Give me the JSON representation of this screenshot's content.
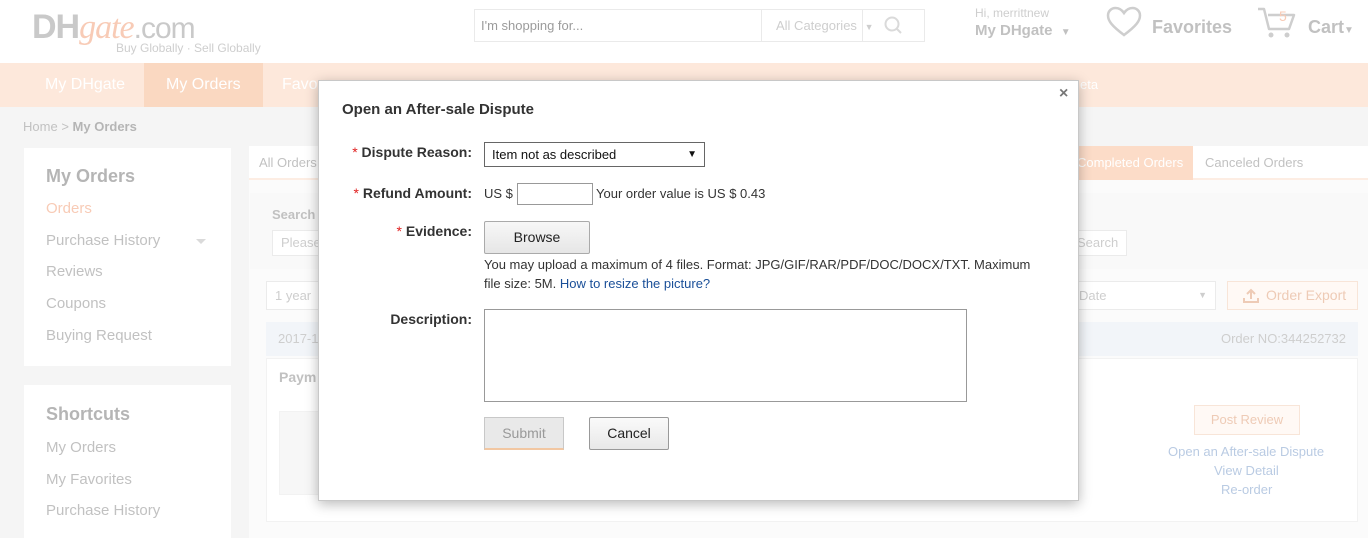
{
  "header": {
    "logo": {
      "dh": "DH",
      "gate": "gate",
      "com": ".com",
      "tagline": "Buy Globally · Sell Globally"
    },
    "search": {
      "placeholder": "I'm shopping for...",
      "category": "All Categories"
    },
    "user": {
      "greeting": "Hi, merrittnew",
      "account_label": "My DHgate"
    },
    "favorites_label": "Favorites",
    "cart": {
      "count": "5",
      "label": "Cart"
    }
  },
  "nav": {
    "items": [
      {
        "label": "My DHgate"
      },
      {
        "label": "My Orders"
      },
      {
        "label": "Favo"
      }
    ],
    "beta_label": "eta"
  },
  "breadcrumb": {
    "home": "Home",
    "separator": ">",
    "current": "My Orders"
  },
  "sidebar": {
    "orders_title": "My Orders",
    "orders_items": [
      "Orders",
      "Purchase History",
      "Reviews",
      "Coupons",
      "Buying Request"
    ],
    "shortcuts_title": "Shortcuts",
    "shortcut_items": [
      "My Orders",
      "My Favorites",
      "Purchase History"
    ]
  },
  "tabs": {
    "all": "All Orders",
    "completed": "Completed Orders",
    "canceled": "Canceled Orders"
  },
  "search_area": {
    "label": "Search",
    "placeholder": "Please",
    "search_button": "Search",
    "period": "1 year",
    "date_field": "Date",
    "export_label": "Order Export"
  },
  "order": {
    "date_prefix": "2017-1",
    "order_no": "Order NO:344252732",
    "status_prefix": "Paym",
    "post_review": "Post Review",
    "links": [
      "Open an After-sale Dispute",
      "View Detail",
      "Re-order"
    ]
  },
  "dialog": {
    "title": "Open an After-sale Dispute",
    "close": "×",
    "required_mark": "*",
    "reason_label": "Dispute Reason:",
    "reason_value": "Item not as described",
    "refund_label": "Refund Amount:",
    "currency_prefix": "US $",
    "refund_value": "",
    "order_value_text": "Your order value is US $ 0.43",
    "evidence_label": "Evidence:",
    "browse_label": "Browse",
    "hint_text": "You may upload a maximum of 4 files. Format: JPG/GIF/RAR/PDF/DOC/DOCX/TXT. Maximum file size: 5M. ",
    "hint_link": "How to resize the picture?",
    "description_label": "Description:",
    "description_value": "",
    "submit_label": "Submit",
    "cancel_label": "Cancel"
  },
  "colors": {
    "brand_orange": "#f5b79a",
    "nav_background": "#fce0cd",
    "link_blue": "#1a4f98",
    "required_red": "#e02020"
  }
}
